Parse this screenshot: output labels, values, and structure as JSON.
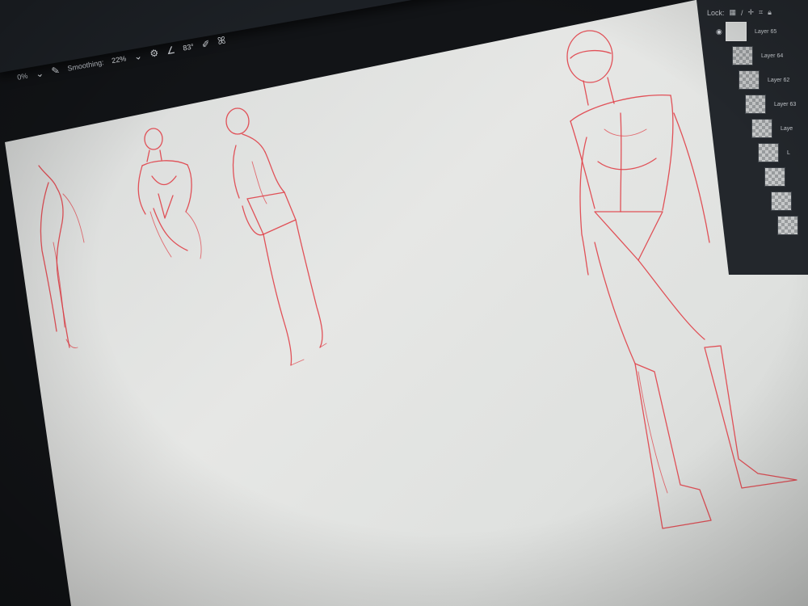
{
  "toolbar": {
    "zoom_fragment": "0%",
    "smoothing_label": "Smoothing:",
    "smoothing_value": "22%",
    "angle_value": "83°",
    "icons": [
      "brush-icon",
      "gear-icon",
      "angle-icon",
      "pressure-icon",
      "butterfly-symmetry-icon"
    ]
  },
  "layers_panel": {
    "lock_label": "Lock:",
    "layers": [
      {
        "name": "Layer 65",
        "active": true
      },
      {
        "name": "Layer 64",
        "active": false
      },
      {
        "name": "Layer 62",
        "active": false
      },
      {
        "name": "Layer 63",
        "active": false
      },
      {
        "name": "Laye",
        "active": false
      },
      {
        "name": "L",
        "active": false
      },
      {
        "name": "",
        "active": false
      },
      {
        "name": "",
        "active": false
      },
      {
        "name": "",
        "active": false
      }
    ]
  },
  "colors": {
    "sketch_stroke": "#e04048",
    "canvas": "#e3e4e2",
    "ui_dark": "#1d2126"
  }
}
